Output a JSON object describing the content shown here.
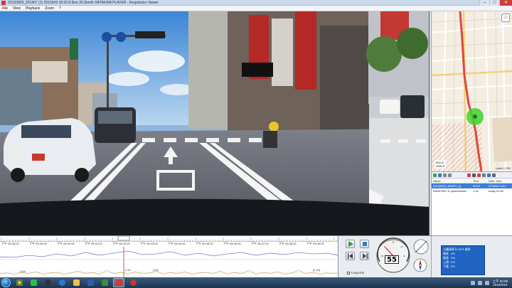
{
  "window": {
    "title": "20150609_201407 (1)   2015/6/9 18:33   8.3km   20.3km/h   DATAKAM PLAYER - Registrator Viewer",
    "min_glyph": "–",
    "max_glyph": "□",
    "close_glyph": "✕"
  },
  "menu": [
    "File",
    "View",
    "Playback",
    "Zoom",
    "?"
  ],
  "timeline": {
    "tick_labels": [
      "下午 06:38:00",
      "下午 06:39:00",
      "下午 06:40:00",
      "下午 06:41:00",
      "下午 06:42:00",
      "下午 06:43:00",
      "下午 06:44:00",
      "下午 06:45:00",
      "下午 06:46:00",
      "下午 06:47:00",
      "下午 06:48:00",
      "下午 06:49:00"
    ],
    "graph_labels": [
      "2.64",
      "2.52",
      "2.64",
      "[4.42]"
    ]
  },
  "controls": {
    "speed": "55",
    "loop_label": "Loop 6-8"
  },
  "filelist": {
    "headers": {
      "name": "Name",
      "time": "Time",
      "date": "Date, time"
    },
    "rows": [
      {
        "name": "20150609_182207 (1)",
        "time": "33:00",
        "date": "2015/6/9 18:2"
      },
      {
        "name": "DAVE0001 D speedresults",
        "time": "1:32",
        "date": "today 01:54"
      }
    ]
  },
  "map": {
    "scale_m": "500 m",
    "scale_ft": "2000 ft",
    "attribution": "Leaflet | OSM",
    "corner_glyph": "◇"
  },
  "gps_popup": {
    "title": "卡羅達車卡 GPS 資料",
    "rows": [
      {
        "label": "緯度",
        "value": "0%"
      },
      {
        "label": "經度",
        "value": "0%"
      },
      {
        "label": "路線",
        "value": ""
      },
      {
        "label": "上傳",
        "value": "0%"
      },
      {
        "label": "下載",
        "value": "0%"
      }
    ]
  },
  "taskbar": {
    "clock_time": "上午 02:08",
    "clock_date": "2015/6/16"
  },
  "colors": {
    "accent": "#3c7fd6",
    "route": "#e0473b",
    "position_marker": "#3fd22f",
    "sky": "#8fb6de"
  }
}
